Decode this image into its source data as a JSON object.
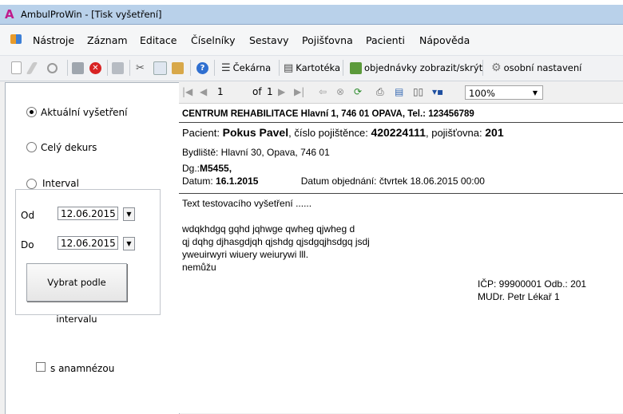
{
  "window": {
    "title": "AmbulProWin  - [Tisk vyšetření]"
  },
  "menu": [
    "Nástroje",
    "Záznam",
    "Editace",
    "Číselníky",
    "Sestavy",
    "Pojišťovna",
    "Pacienti",
    "Nápověda"
  ],
  "toolbar": {
    "cekarna": "Čekárna",
    "kartoteka": "Kartotéka",
    "objednavky": "objednávky zobrazit/skrýt",
    "osobni": "osobní nastavení"
  },
  "left_panel": {
    "opt_current": "Aktuální vyšetření",
    "opt_all": "Celý dekurs",
    "opt_interval": "Interval",
    "od_label": "Od",
    "od_value": "12.06.2015",
    "do_label": "Do",
    "do_value": "12.06.2015",
    "interval_button": "Vybrat podle intervalu",
    "anamnesis": "s anamnézou",
    "selected": "current"
  },
  "report_toolbar": {
    "page": "1",
    "of_label": "of",
    "page_count": "1",
    "zoom": "100%"
  },
  "report": {
    "header": "CENTRUM REHABILITACE Hlavní 1, 746 01 OPAVA, Tel.: 123456789",
    "patient_label": "Pacient:",
    "patient_name": "Pokus Pavel",
    "insurance_no_label": ", číslo pojištěnce:",
    "insurance_no": "420224111",
    "insurer_label": ",  pojišťovna:",
    "insurer": "201",
    "address": "Bydliště: Hlavní  30, Opava, 746 01",
    "dg_label": "Dg.:",
    "dg": "M5455,",
    "date_label": "Datum:",
    "date": "16.1.2015",
    "order_date": "Datum objednání: čtvrtek 18.06.2015 00:00",
    "body": [
      "Text testovacího vyšetření ......",
      "",
      "wdqkhdgq gqhd jqhwge qwheg qjwheg d",
      "qj dqhg djhasgdjqh qjshdg qjsdgqjhsdgq jsdj",
      "yweuirwyri wiuery weiurywi  lll.",
      "nemůžu"
    ],
    "icp": "IČP: 99900001   Odb.: 201",
    "doctor": "MUDr. Petr Lékař 1"
  }
}
